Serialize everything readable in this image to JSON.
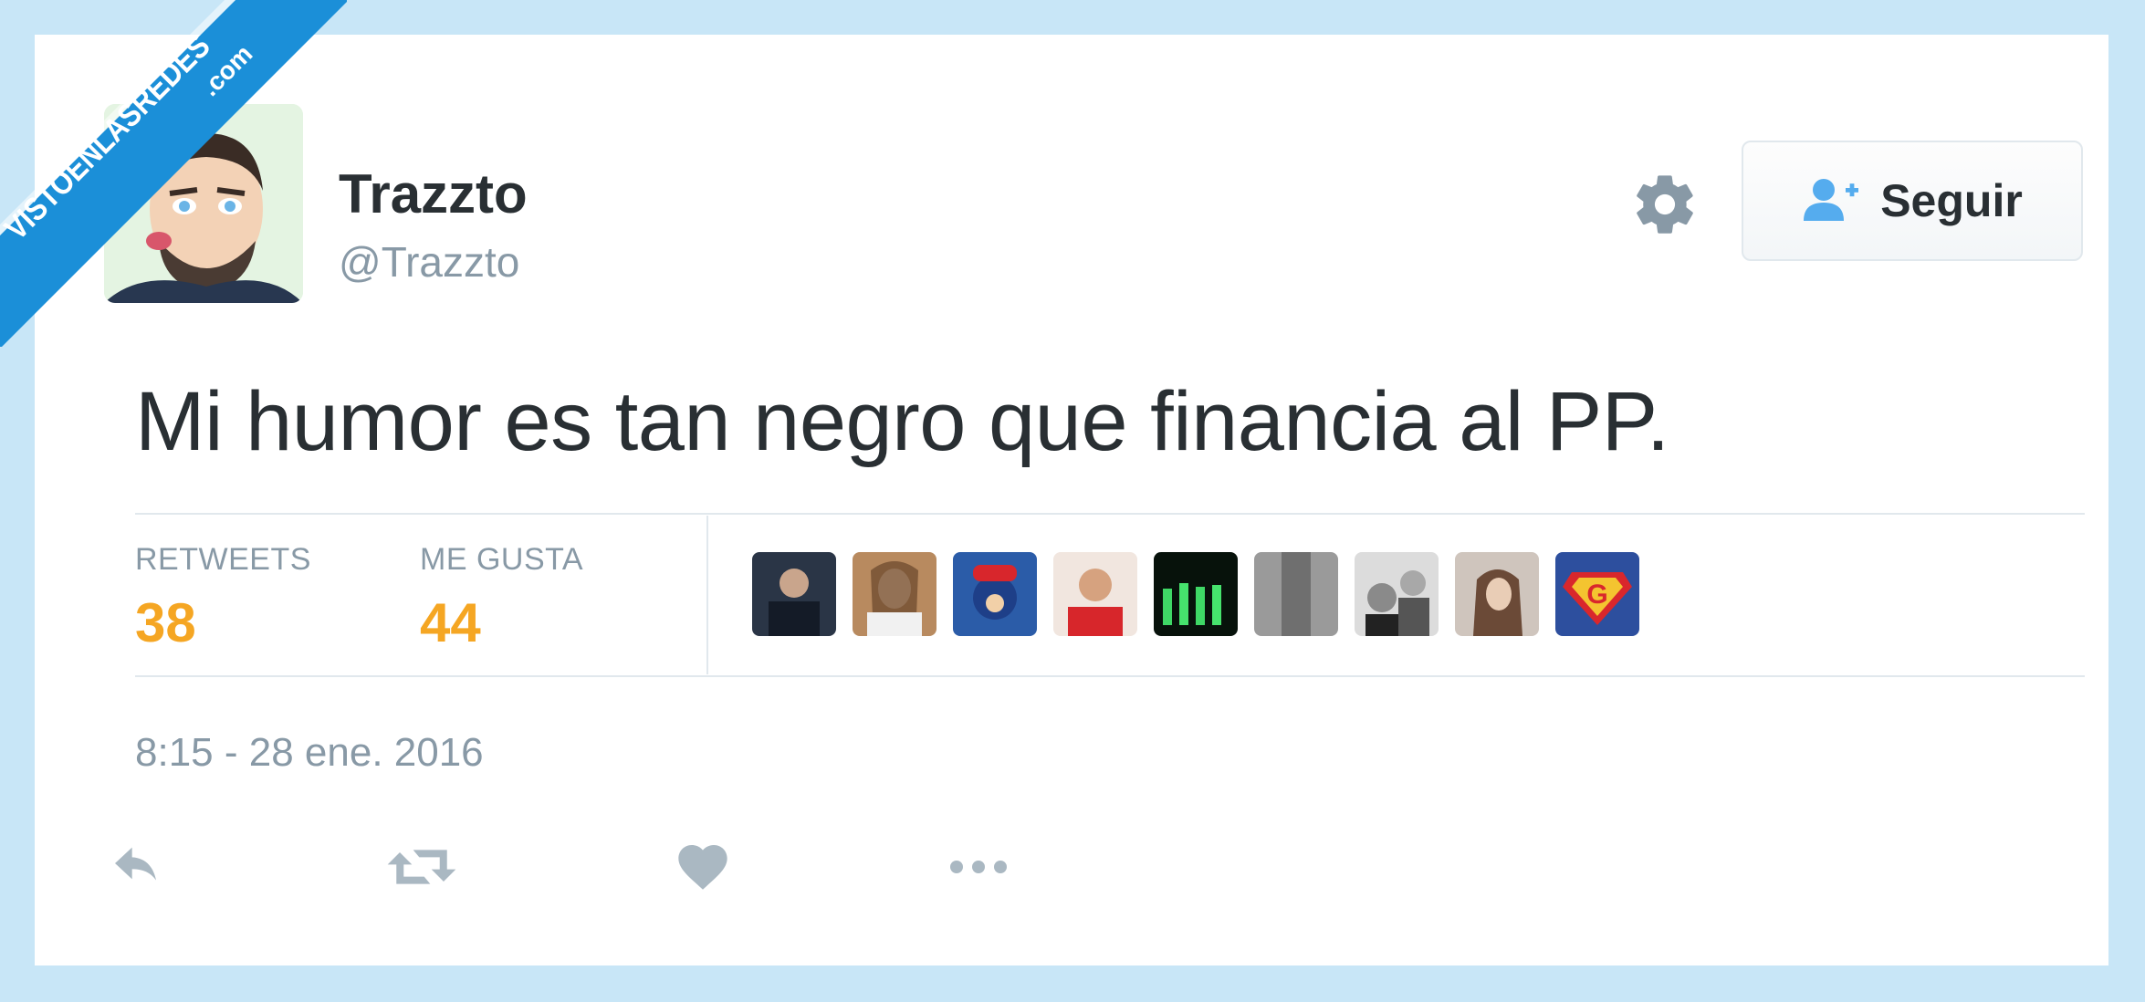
{
  "watermark": {
    "text": "VISTOENLASREDES",
    "suffix": ".com"
  },
  "tweet": {
    "author_name": "Trazzto",
    "author_handle": "@Trazzto",
    "follow_label": "Seguir",
    "text": "Mi humor es tan negro que financia al PP.",
    "stats": {
      "retweets_label": "RETWEETS",
      "retweets_value": "38",
      "likes_label": "ME GUSTA",
      "likes_value": "44"
    },
    "timestamp": "8:15 - 28 ene. 2016"
  },
  "icons": {
    "settings": "gear-icon",
    "follow": "add-user-icon",
    "reply": "reply-icon",
    "retweet": "retweet-icon",
    "like": "heart-icon",
    "more": "more-icon"
  },
  "colors": {
    "background": "#c8e6f7",
    "badge": "#1b8fd8",
    "count": "#f5a623",
    "muted": "#8899a6",
    "action_icon": "#aab8c2"
  }
}
